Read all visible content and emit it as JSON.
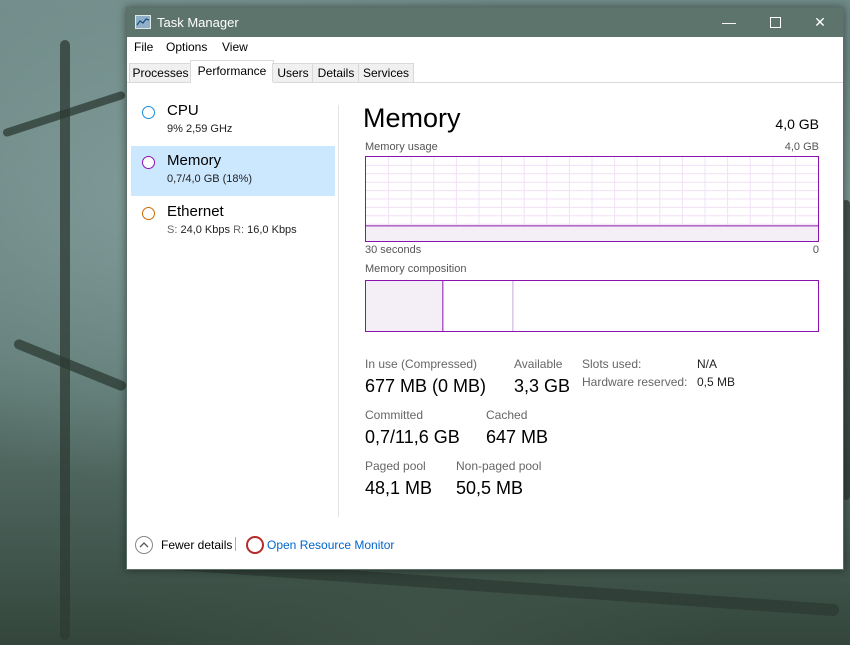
{
  "window": {
    "title": "Task Manager"
  },
  "window_controls": {
    "minimize": "—",
    "close": "✕"
  },
  "menu": [
    "File",
    "Options",
    "View"
  ],
  "tabs": [
    {
      "label": "Processes",
      "active": false
    },
    {
      "label": "Performance",
      "active": true
    },
    {
      "label": "Users",
      "active": false
    },
    {
      "label": "Details",
      "active": false
    },
    {
      "label": "Services",
      "active": false
    }
  ],
  "sidebar": [
    {
      "title": "CPU",
      "subtitle": "9% 2,59 GHz",
      "color": "#1a8cd8",
      "selected": false
    },
    {
      "title": "Memory",
      "subtitle": "0,7/4,0 GB (18%)",
      "color": "#8b12ae",
      "selected": true
    },
    {
      "title": "Ethernet",
      "sub_s_label": "S:",
      "sub_s_value": "24,0 Kbps",
      "sub_r_label": "R:",
      "sub_r_value": "16,0 Kbps",
      "color": "#cc6a00",
      "selected": false
    }
  ],
  "main": {
    "title": "Memory",
    "total": "4,0 GB",
    "usage_label": "Memory usage",
    "usage_max": "4,0 GB",
    "time_span": "30 seconds",
    "time_end": "0",
    "composition_label": "Memory composition",
    "usage_fraction": 0.18,
    "composition_in_use_fraction": 0.17,
    "composition_modified_fraction": 0.155
  },
  "stats": {
    "in_use_label": "In use (Compressed)",
    "in_use_value": "677 MB (0 MB)",
    "available_label": "Available",
    "available_value": "3,3 GB",
    "committed_label": "Committed",
    "committed_value": "0,7/11,6 GB",
    "cached_label": "Cached",
    "cached_value": "647 MB",
    "paged_label": "Paged pool",
    "paged_value": "48,1 MB",
    "nonpaged_label": "Non-paged pool",
    "nonpaged_value": "50,5 MB",
    "slots_label": "Slots used:",
    "slots_value": "N/A",
    "hwres_label": "Hardware reserved:",
    "hwres_value": "0,5 MB"
  },
  "footer": {
    "fewer_details": "Fewer details",
    "open_monitor": "Open Resource Monitor"
  },
  "accent_color": "#8b12ae"
}
